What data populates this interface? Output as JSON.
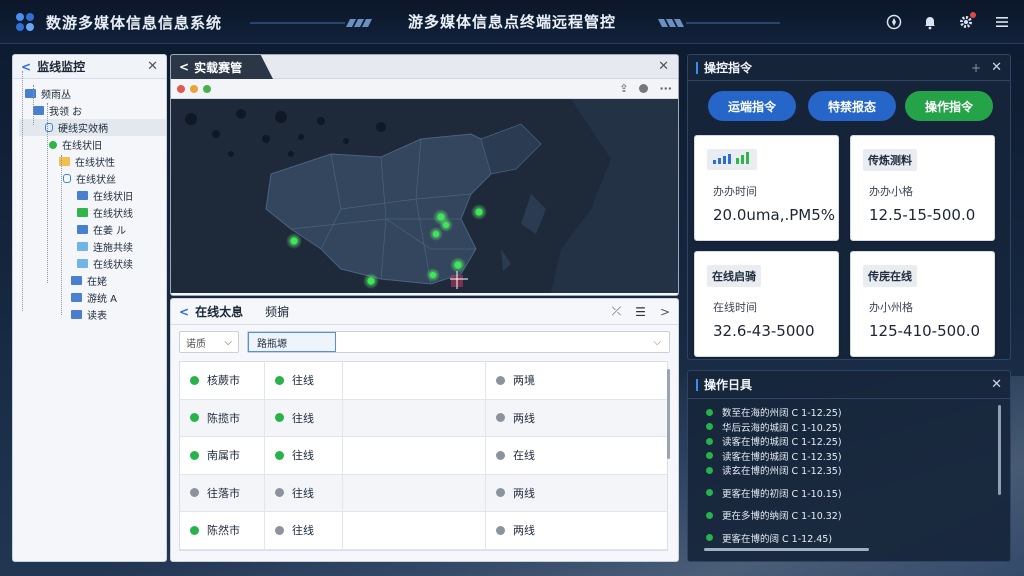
{
  "header": {
    "app_title": "数游多媒体信息信息系统",
    "center_title": "游多媒体信息点终端远程管控",
    "icons": [
      "compass-icon",
      "bell-icon",
      "gear-icon",
      "menu-icon"
    ]
  },
  "tree_panel": {
    "title": "监线监控",
    "nodes": [
      {
        "label": "频雨丛",
        "icon": "blue-folder"
      },
      {
        "label": "我领 お",
        "icon": "blue-folder"
      },
      {
        "label": "硬线实效柄",
        "icon": "lock-icon"
      },
      {
        "label": "在线状旧",
        "icon": "green-dot"
      },
      {
        "label": "在线状性",
        "icon": "yellow-folder"
      },
      {
        "label": "在线状丝",
        "icon": "shield-icon"
      },
      {
        "label": "在线状旧",
        "icon": "blue-folder"
      },
      {
        "label": "在线状线",
        "icon": "green-leaf"
      },
      {
        "label": "在姜 ル",
        "icon": "blue-folder"
      },
      {
        "label": "连施共续",
        "icon": "cyan-folder"
      },
      {
        "label": "在线状续",
        "icon": "cyan-folder"
      },
      {
        "label": "在姥",
        "icon": "blue-folder"
      },
      {
        "label": "游统 A",
        "icon": "blue-folder"
      },
      {
        "label": "读表",
        "icon": "blue-folder"
      }
    ]
  },
  "map_window": {
    "tab_label": "实载赛管"
  },
  "online_panel": {
    "title": "在线太息",
    "subtitle": "频掮",
    "select_placeholder": "诺质",
    "search_value": "路瓶塬",
    "rows": [
      {
        "name": "核蕨市",
        "name_status": "green",
        "state": "往线",
        "state_status": "green",
        "net": "两境",
        "net_status": "gray"
      },
      {
        "name": "陈揽市",
        "name_status": "green",
        "state": "往线",
        "state_status": "green",
        "net": "两线",
        "net_status": "gray"
      },
      {
        "name": "南属市",
        "name_status": "green",
        "state": "往线",
        "state_status": "green",
        "net": "在线",
        "net_status": "gray"
      },
      {
        "name": "往落市",
        "name_status": "gray",
        "state": "往线",
        "state_status": "gray",
        "net": "两线",
        "net_status": "gray"
      },
      {
        "name": "陈然市",
        "name_status": "green",
        "state": "往线",
        "state_status": "gray",
        "net": "两线",
        "net_status": "gray"
      }
    ]
  },
  "command_panel": {
    "title": "操控指令",
    "buttons": [
      {
        "label": "运端指令",
        "color": "#2566c8"
      },
      {
        "label": "特禁报态",
        "color": "#2566c8"
      },
      {
        "label": "操作指令",
        "color": "#25a348"
      }
    ],
    "cards": [
      {
        "label": "",
        "sub": "办办时间",
        "value": "20.0uma,.PM5%"
      },
      {
        "label": "传炼测料",
        "sub": "办办小格",
        "value": "12.5-15-500.0"
      },
      {
        "label": "在线启骑",
        "sub": "在线时间",
        "value": "32.6-43-5000"
      },
      {
        "label": "传庑在线",
        "sub": "办小州格",
        "value": "125-410-500.0"
      }
    ]
  },
  "log_panel": {
    "title": "操作日具",
    "entries": [
      "数至在海的州阔 C 1-12.25)",
      "华后云海的城阔 C 1-10.25)",
      "读客在博的城阔 C 1-12.25)",
      "读客在博的城阔 C 1-12.35)",
      "读玄在博的州阔 C 1-12.35)",
      "更客在博的初阔 C 1-10.15)",
      "更在多博的纳阔 C 1-10.32)",
      "更客在博的阔 C 1-12.45)"
    ]
  }
}
